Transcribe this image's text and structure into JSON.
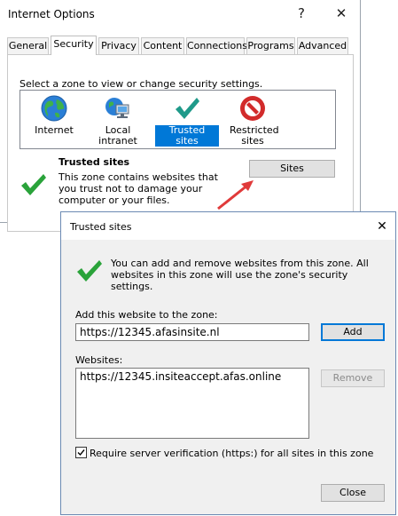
{
  "internet_options": {
    "title": "Internet Options",
    "help_glyph": "?",
    "close_glyph": "✕",
    "tabs": [
      "General",
      "Security",
      "Privacy",
      "Content",
      "Connections",
      "Programs",
      "Advanced"
    ],
    "active_tab": "Security",
    "zone_prompt": "Select a zone to view or change security settings.",
    "zones": [
      {
        "label": "Internet",
        "icon": "globe-icon"
      },
      {
        "label": "Local intranet",
        "icon": "intranet-icon"
      },
      {
        "label": "Trusted sites",
        "icon": "checkmark-icon",
        "selected": true
      },
      {
        "label": "Restricted sites",
        "icon": "restricted-icon"
      }
    ],
    "zone_info": {
      "name": "Trusted sites",
      "description": "This zone contains websites that you trust not to damage your computer or your files."
    },
    "sites_button": "Sites"
  },
  "trusted_sites": {
    "title": "Trusted sites",
    "close_glyph": "✕",
    "info": "You can add and remove websites from this zone. All websites in this zone will use the zone's security settings.",
    "add_label": "Add this website to the zone:",
    "add_value": "https://12345.afasinsite.nl",
    "add_button": "Add",
    "websites_label": "Websites:",
    "websites": [
      "https://12345.insiteaccept.afas.online"
    ],
    "remove_button": "Remove",
    "require_verification": "Require server verification (https:) for all sites in this zone",
    "require_checked": true,
    "close_button": "Close"
  },
  "colors": {
    "selection": "#0078d7",
    "check_green": "#2aa33a",
    "arrow_red": "#e03a3a"
  }
}
